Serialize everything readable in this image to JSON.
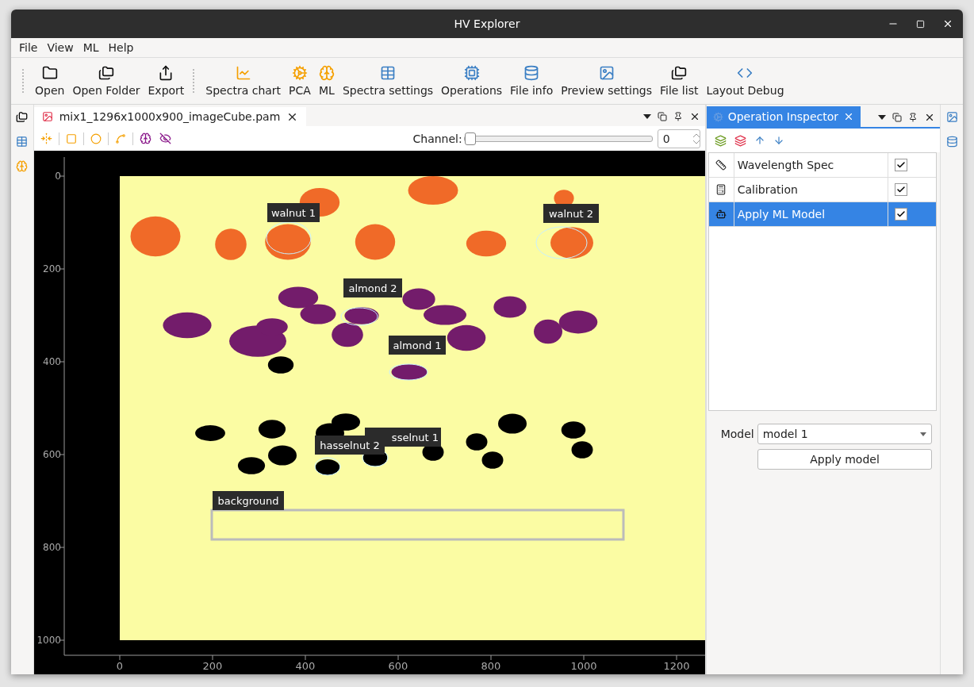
{
  "window": {
    "title": "HV Explorer"
  },
  "menu": [
    "File",
    "View",
    "ML",
    "Help"
  ],
  "toolbar": [
    {
      "label": "Open"
    },
    {
      "label": "Open Folder"
    },
    {
      "label": "Export"
    },
    {
      "label": "Spectra chart"
    },
    {
      "label": "PCA"
    },
    {
      "label": "ML"
    },
    {
      "label": "Spectra settings"
    },
    {
      "label": "Operations"
    },
    {
      "label": "File info"
    },
    {
      "label": "Preview settings"
    },
    {
      "label": "File list"
    },
    {
      "label": "Layout Debug"
    }
  ],
  "document": {
    "tab": {
      "label": "mix1_1296x1000x900_imageCube.pam",
      "selected": true
    },
    "channel": {
      "label": "Channel:",
      "level": 0,
      "value": "0"
    },
    "x_ticks": [
      "0",
      "200",
      "400",
      "600",
      "800",
      "1000",
      "1200"
    ],
    "y_ticks": [
      "0",
      "200",
      "400",
      "600",
      "800",
      "1000"
    ],
    "regions": [
      {
        "label": "walnut 1"
      },
      {
        "label": "walnut 2"
      },
      {
        "label": "almond 2"
      },
      {
        "label": "almond 1"
      },
      {
        "label": "sselnut 1"
      },
      {
        "label": "hasselnut 2"
      },
      {
        "label": "background"
      }
    ]
  },
  "inspector": {
    "title": "Operation Inspector",
    "selected": true,
    "operations": [
      {
        "name": "Wavelength Spec",
        "checked": true,
        "selected": false
      },
      {
        "name": "Calibration",
        "checked": true,
        "selected": false
      },
      {
        "name": "Apply ML Model",
        "checked": true,
        "selected": true
      }
    ],
    "model_label": "Model",
    "model_value": "model 1",
    "apply_button": "Apply model"
  }
}
